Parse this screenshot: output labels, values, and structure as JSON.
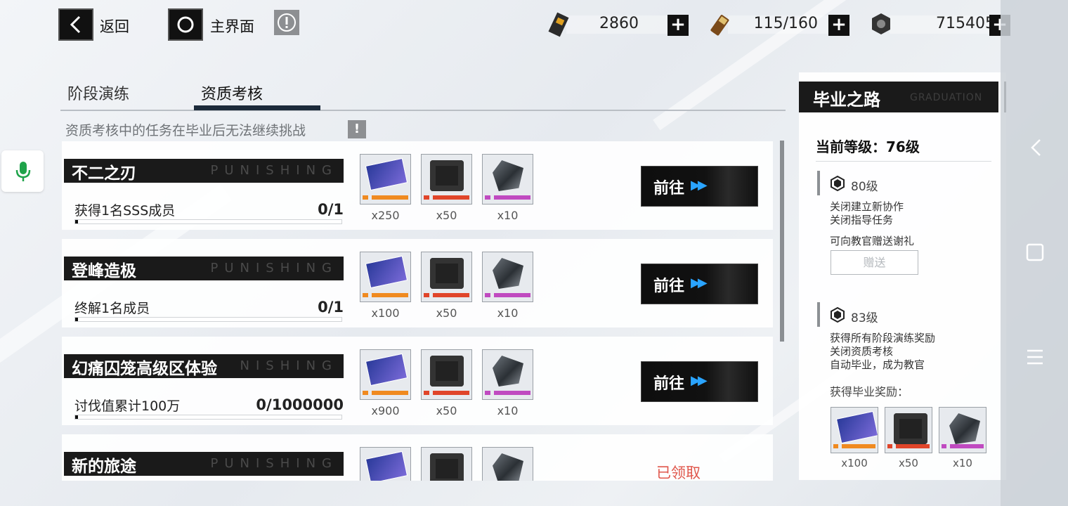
{
  "colors": {
    "accent_blue": "#2aa4ff",
    "claimed_red": "#e0564b",
    "dark": "#111111"
  },
  "topbar": {
    "back_label": "返回",
    "home_label": "主界面",
    "resources": [
      {
        "icon": "ticket-icon",
        "value": "2860"
      },
      {
        "icon": "battery-icon",
        "value": "115/160"
      },
      {
        "icon": "gear-nut-icon",
        "value": "715405"
      }
    ]
  },
  "tabs": [
    {
      "label": "阶段演练"
    },
    {
      "label": "资质考核",
      "active": true
    }
  ],
  "notice": "资质考核中的任务在毕业后无法继续挑战",
  "tasks": [
    {
      "title": "不二之刃",
      "watermark": "PUNISHING",
      "desc": "获得1名SSS成员",
      "progress": "0/1",
      "fraction": 0,
      "rewards": [
        {
          "icon": "blue-card-icon",
          "qty": "x250"
        },
        {
          "icon": "red-chip-icon",
          "qty": "x50"
        },
        {
          "icon": "crystal-icon",
          "qty": "x10"
        }
      ],
      "action": "前往"
    },
    {
      "title": "登峰造极",
      "watermark": "PUNISHING",
      "desc": "终解1名成员",
      "progress": "0/1",
      "fraction": 0,
      "rewards": [
        {
          "icon": "blue-card-icon",
          "qty": "x100"
        },
        {
          "icon": "red-chip-icon",
          "qty": "x50"
        },
        {
          "icon": "crystal-icon",
          "qty": "x10"
        }
      ],
      "action": "前往"
    },
    {
      "title": "幻痛囚笼高级区体验",
      "watermark": "NISHING",
      "desc": "讨伐值累计100万",
      "progress": "0/1000000",
      "fraction": 0,
      "rewards": [
        {
          "icon": "blue-card-icon",
          "qty": "x900"
        },
        {
          "icon": "red-chip-icon",
          "qty": "x50"
        },
        {
          "icon": "crystal-icon",
          "qty": "x10"
        }
      ],
      "action": "前往"
    },
    {
      "title": "新的旅途",
      "watermark": "PUNISHING",
      "rewards": [
        {
          "icon": "blue-card-icon"
        },
        {
          "icon": "red-chip-icon"
        },
        {
          "icon": "crystal-icon"
        }
      ],
      "status": "已领取"
    }
  ],
  "panel": {
    "title": "毕业之路",
    "subtitle_en": "GRADUATION",
    "current_level": "当前等级：76级",
    "levels": [
      {
        "name": "80级",
        "lines": [
          "关闭建立新协作",
          "关闭指导任务"
        ],
        "gift_text": "可向教官赠送谢礼",
        "gift_button": "赠送"
      },
      {
        "name": "83级",
        "lines": [
          "获得所有阶段演练奖励",
          "关闭资质考核",
          "自动毕业，成为教官"
        ]
      }
    ],
    "graduation_label": "获得毕业奖励：",
    "rewards": [
      {
        "icon": "blue-card-icon",
        "qty": "x100"
      },
      {
        "icon": "red-chip-icon",
        "qty": "x50"
      },
      {
        "icon": "crystal-icon",
        "qty": "x10"
      }
    ]
  }
}
